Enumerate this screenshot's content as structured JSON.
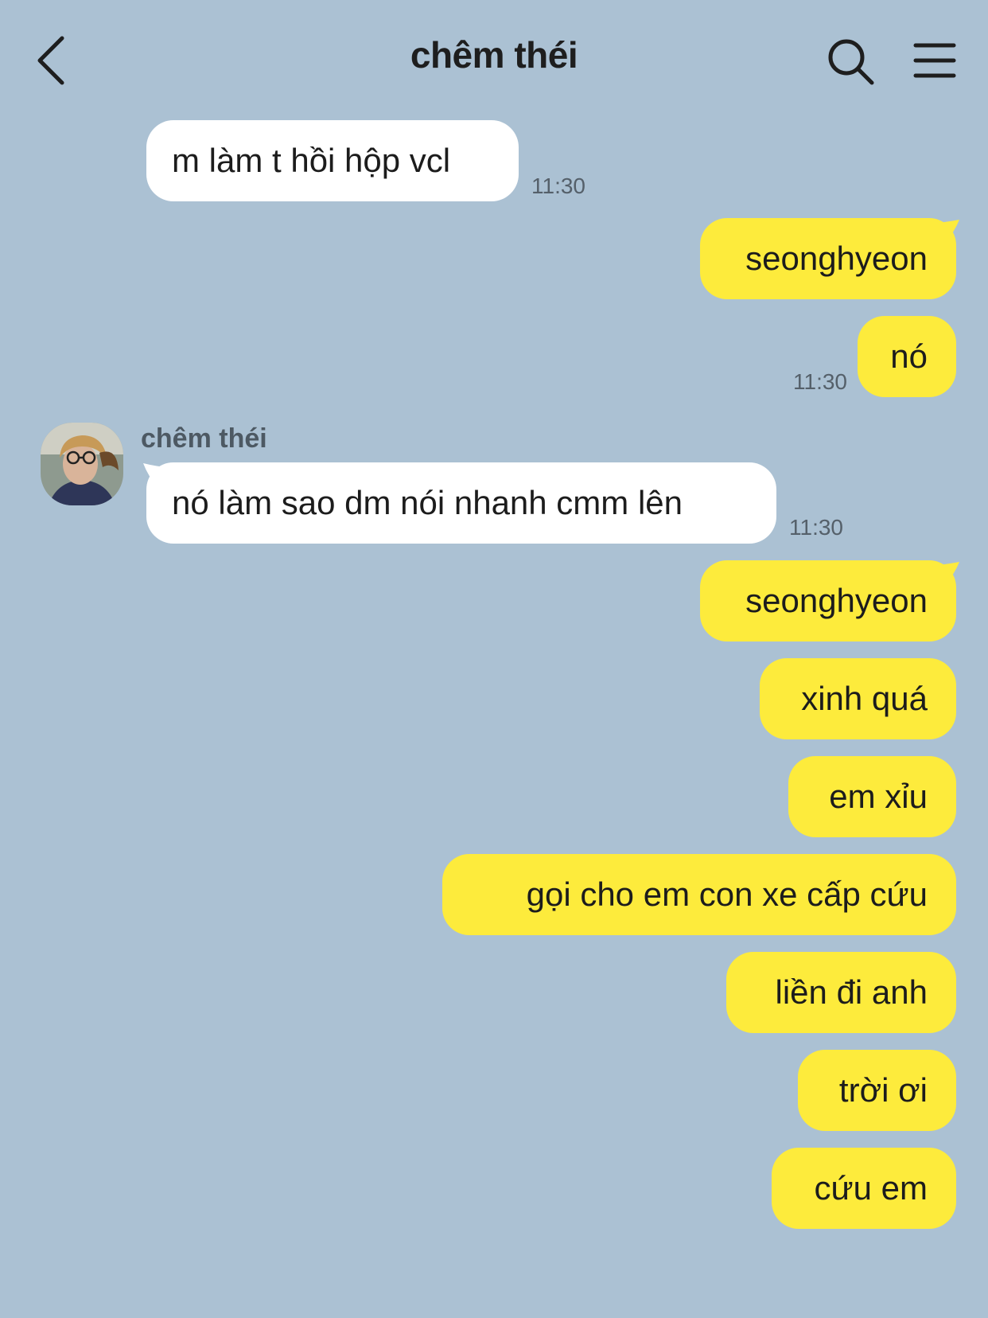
{
  "header": {
    "title": "chêm théi",
    "back_icon": "chevron-left-icon",
    "search_icon": "search-icon",
    "menu_icon": "hamburger-menu-icon"
  },
  "colors": {
    "background": "#abc1d3",
    "incoming_bubble": "#ffffff",
    "outgoing_bubble": "#fdeb3c"
  },
  "messages": [
    {
      "direction": "incoming",
      "text": "m làm t hồi hộp vcl",
      "time": "11:30"
    },
    {
      "direction": "outgoing",
      "text": "seonghyeon"
    },
    {
      "direction": "outgoing",
      "text": "nó",
      "time": "11:30"
    },
    {
      "direction": "incoming",
      "sender": "chêm théi",
      "text": "nó làm sao dm nói nhanh cmm lên",
      "time": "11:30"
    },
    {
      "direction": "outgoing",
      "text": "seonghyeon"
    },
    {
      "direction": "outgoing",
      "text": "xinh quá"
    },
    {
      "direction": "outgoing",
      "text": "em xỉu"
    },
    {
      "direction": "outgoing",
      "text": "gọi cho em con xe cấp cứu"
    },
    {
      "direction": "outgoing",
      "text": "liền đi anh"
    },
    {
      "direction": "outgoing",
      "text": "trời ơi"
    },
    {
      "direction": "outgoing",
      "text": "cứu em"
    }
  ]
}
